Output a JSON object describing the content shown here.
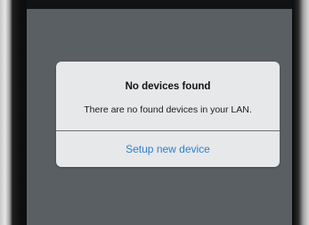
{
  "dialog": {
    "title": "No devices found",
    "message": "There are no found devices in your LAN.",
    "action_label": "Setup new device"
  },
  "colors": {
    "screen_background": "#5a5f63",
    "dialog_background": "#e7e8ea",
    "action_text": "#2f7ed0"
  }
}
